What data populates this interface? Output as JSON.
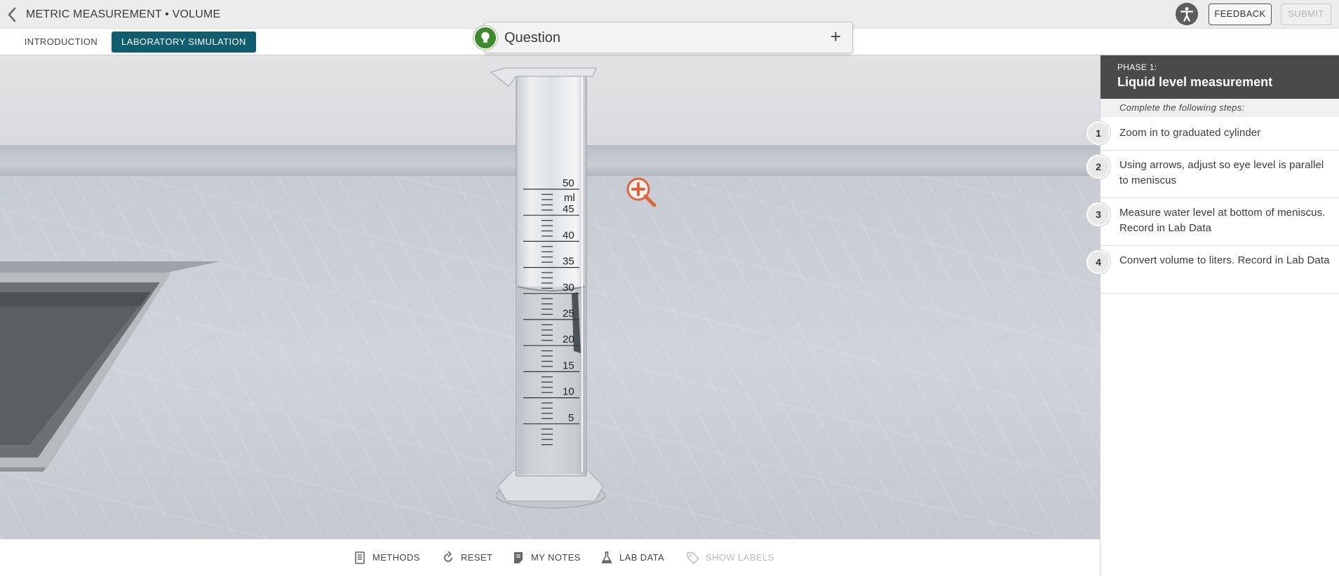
{
  "header": {
    "title": "METRIC MEASUREMENT • VOLUME",
    "feedback_label": "FEEDBACK",
    "submit_label": "SUBMIT"
  },
  "tabs": [
    {
      "label": "INTRODUCTION",
      "active": false
    },
    {
      "label": "LABORATORY SIMULATION",
      "active": true
    }
  ],
  "question": {
    "label": "Question",
    "expand_symbol": "+"
  },
  "scene": {
    "cylinder": {
      "unit": "ml",
      "scale_labels": [
        "50",
        "45",
        "40",
        "35",
        "30",
        "25",
        "20",
        "15",
        "10",
        "5"
      ],
      "water_level_ml": 30
    }
  },
  "toolbar": {
    "items": [
      {
        "label": "METHODS",
        "icon": "methods-icon",
        "enabled": true
      },
      {
        "label": "RESET",
        "icon": "reset-icon",
        "enabled": true
      },
      {
        "label": "MY NOTES",
        "icon": "notes-icon",
        "enabled": true
      },
      {
        "label": "LAB DATA",
        "icon": "flask-icon",
        "enabled": true
      },
      {
        "label": "SHOW LABELS",
        "icon": "tag-icon",
        "enabled": false
      }
    ]
  },
  "panel": {
    "phase_label": "PHASE 1:",
    "phase_title": "Liquid level measurement",
    "intro": "Complete the following steps:",
    "steps": [
      {
        "number": "1",
        "text": "Zoom in to graduated cylinder"
      },
      {
        "number": "2",
        "text": "Using arrows, adjust so eye level is parallel to meniscus"
      },
      {
        "number": "3",
        "text": "Measure water level at bottom of meniscus. Record in Lab Data"
      },
      {
        "number": "4",
        "text": "Convert volume to liters. Record in Lab Data"
      }
    ]
  },
  "colors": {
    "active_tab": "#0f5d6e",
    "bulb": "#3d8b2c",
    "zoom": "#e0643a",
    "phase_header": "#4a4a4a"
  }
}
